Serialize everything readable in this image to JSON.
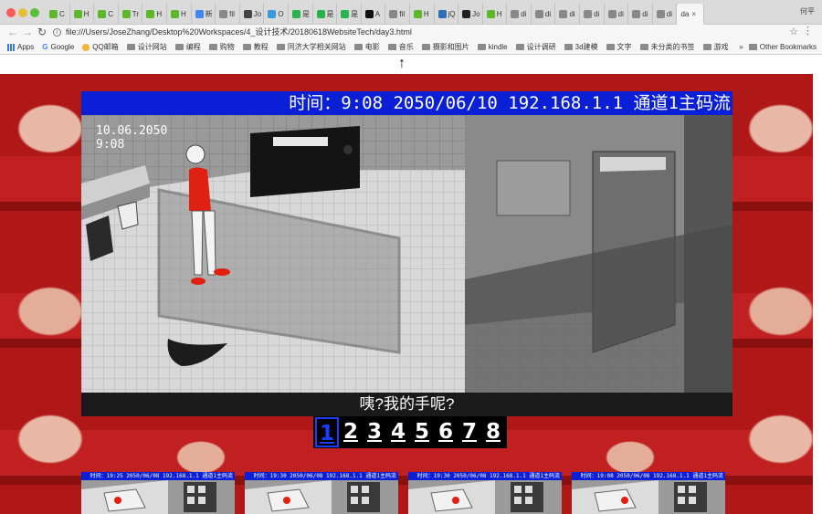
{
  "browser": {
    "tabs": [
      {
        "label": "C",
        "color": "#5cb82a"
      },
      {
        "label": "H",
        "color": "#5cb82a"
      },
      {
        "label": "C",
        "color": "#5cb82a"
      },
      {
        "label": "Tr",
        "color": "#5cb82a"
      },
      {
        "label": "H",
        "color": "#5cb82a"
      },
      {
        "label": "H",
        "color": "#5cb82a"
      },
      {
        "label": "新",
        "color": "#4285f4"
      },
      {
        "label": "fil",
        "color": "#888888"
      },
      {
        "label": "Jo",
        "color": "#444444"
      },
      {
        "label": "O",
        "color": "#3a9ad9"
      },
      {
        "label": "是",
        "color": "#29b34d"
      },
      {
        "label": "是",
        "color": "#29b34d"
      },
      {
        "label": "是",
        "color": "#29b34d"
      },
      {
        "label": "A",
        "color": "#111111"
      },
      {
        "label": "fil",
        "color": "#888888"
      },
      {
        "label": "H",
        "color": "#5cb82a"
      },
      {
        "label": "jQ",
        "color": "#2b6fb5"
      },
      {
        "label": "Jo",
        "color": "#222222"
      },
      {
        "label": "H",
        "color": "#5cb82a"
      },
      {
        "label": "di",
        "color": "#888888"
      },
      {
        "label": "di",
        "color": "#888888"
      },
      {
        "label": "di",
        "color": "#888888"
      },
      {
        "label": "di",
        "color": "#888888"
      },
      {
        "label": "di",
        "color": "#888888"
      },
      {
        "label": "di",
        "color": "#888888"
      },
      {
        "label": "di",
        "color": "#888888"
      }
    ],
    "active_tab": {
      "label": "da",
      "close": "×"
    },
    "profile": "何平",
    "url": "file:///Users/JoseZhang/Desktop%20Workspaces/4_设计技术/20180618WebsiteTech/day3.html",
    "back_icon": "←",
    "forward_icon": "→",
    "reload_icon": "↻",
    "star_icon": "☆",
    "menu_icon": "⋮",
    "bookmarks": [
      {
        "label": "Apps",
        "kind": "apps"
      },
      {
        "label": "Google",
        "kind": "google"
      },
      {
        "label": "QQ邮箱",
        "kind": "qq"
      },
      {
        "label": "设计网站",
        "kind": "folder"
      },
      {
        "label": "编程",
        "kind": "folder"
      },
      {
        "label": "购物",
        "kind": "folder"
      },
      {
        "label": "教程",
        "kind": "folder"
      },
      {
        "label": "同济大学相关网站",
        "kind": "folder"
      },
      {
        "label": "电影",
        "kind": "folder"
      },
      {
        "label": "音乐",
        "kind": "folder"
      },
      {
        "label": "摄影和图片",
        "kind": "folder"
      },
      {
        "label": "kindle",
        "kind": "folder"
      },
      {
        "label": "设计调研",
        "kind": "folder"
      },
      {
        "label": "3d建模",
        "kind": "folder"
      },
      {
        "label": "文字",
        "kind": "folder"
      },
      {
        "label": "未分类的书签",
        "kind": "folder"
      },
      {
        "label": "游戏",
        "kind": "folder"
      }
    ],
    "bookmarks_more": "»",
    "other_bookmarks": "Other Bookmarks"
  },
  "page": {
    "up_arrow": "↑",
    "camera_title": "时间：9:08 2050/06/10 192.168.1.1 通道1主码流",
    "stamp_date": "10.06.2050",
    "stamp_time": "9:08",
    "subtitle": "咦?我的手呢?",
    "pages": [
      "1",
      "2",
      "3",
      "4",
      "5",
      "6",
      "7",
      "8"
    ],
    "active_page": "1",
    "thumbnails": [
      {
        "title": "时间：19:25 2050/06/08 192.168.1.1 通道1主码流"
      },
      {
        "title": "时间：19:30 2050/06/08 192.168.1.1 通道1主码流"
      },
      {
        "title": "时间：19:30 2050/06/08 192.168.1.1 通道1主码流"
      },
      {
        "title": "时间：19:08 2050/06/08 192.168.1.1 通道1主码流"
      }
    ]
  }
}
